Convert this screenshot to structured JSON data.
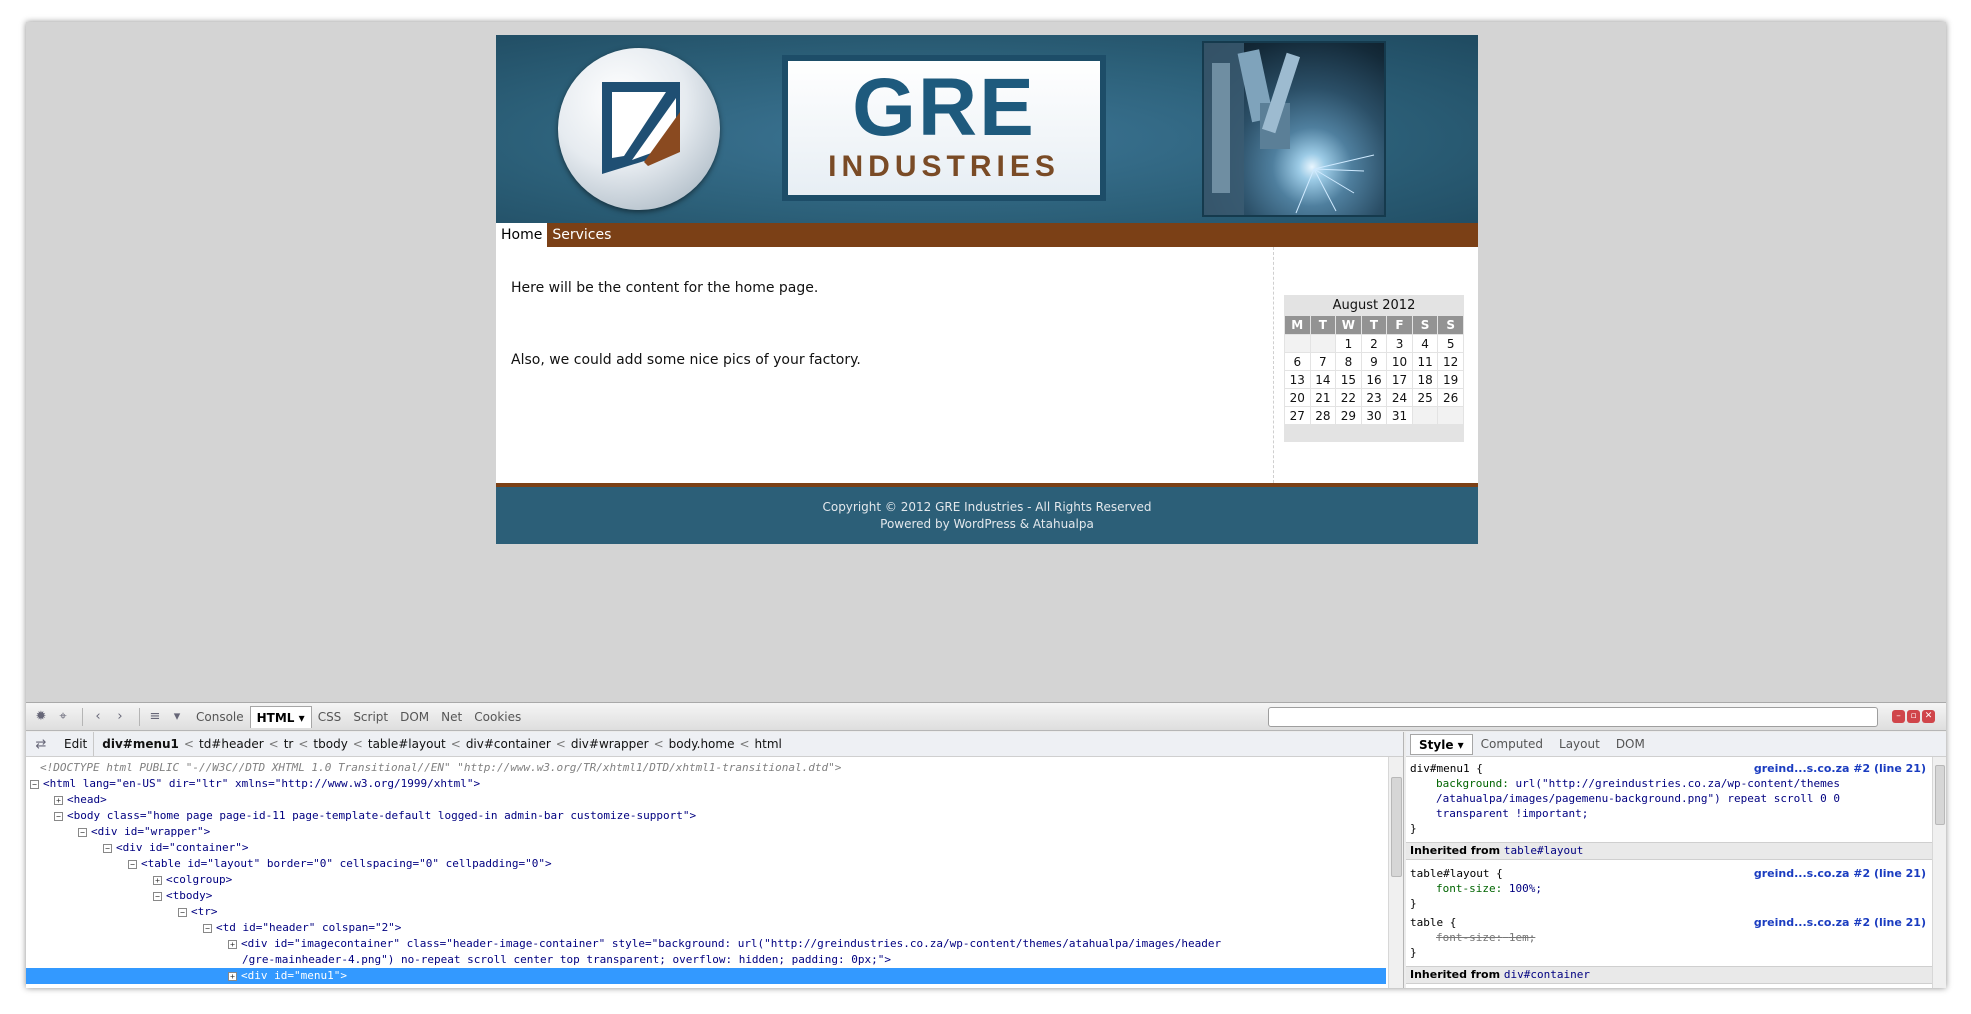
{
  "site": {
    "brand_title": "GRE",
    "brand_subtitle": "INDUSTRIES",
    "menu": [
      {
        "label": "Home"
      },
      {
        "label": "Services"
      }
    ],
    "content": {
      "paragraph1": "Here will be the content for the home page.",
      "paragraph2": "Also, we could add some nice pics of your factory."
    },
    "calendar": {
      "caption": "August 2012",
      "weekdays": [
        "M",
        "T",
        "W",
        "T",
        "F",
        "S",
        "S"
      ],
      "weeks": [
        [
          "",
          "",
          "1",
          "2",
          "3",
          "4",
          "5"
        ],
        [
          "6",
          "7",
          "8",
          "9",
          "10",
          "11",
          "12"
        ],
        [
          "13",
          "14",
          "15",
          "16",
          "17",
          "18",
          "19"
        ],
        [
          "20",
          "21",
          "22",
          "23",
          "24",
          "25",
          "26"
        ],
        [
          "27",
          "28",
          "29",
          "30",
          "31",
          "",
          ""
        ]
      ]
    },
    "footer": {
      "copyright": "Copyright © 2012 GRE Industries - All Rights Reserved",
      "powered": "Powered by WordPress & Atahualpa"
    }
  },
  "devtools": {
    "tabs": [
      "Console",
      "HTML",
      "CSS",
      "Script",
      "DOM",
      "Net",
      "Cookies"
    ],
    "active_tab": "HTML",
    "search_value": "",
    "edit_label": "Edit",
    "breadcrumbs": [
      "div#menu1",
      "td#header",
      "tr",
      "tbody",
      "table#layout",
      "div#container",
      "div#wrapper",
      "body.home",
      "html"
    ],
    "tree_lines": [
      "<!DOCTYPE html PUBLIC \"-//W3C//DTD XHTML 1.0 Transitional//EN\" \"http://www.w3.org/TR/xhtml1/DTD/xhtml1-transitional.dtd\">",
      "<html lang=\"en-US\" dir=\"ltr\" xmlns=\"http://www.w3.org/1999/xhtml\">",
      "<head>",
      "<body class=\"home page page-id-11 page-template-default logged-in admin-bar customize-support\">",
      "<div id=\"wrapper\">",
      "<div id=\"container\">",
      "<table id=\"layout\" border=\"0\" cellspacing=\"0\" cellpadding=\"0\">",
      "<colgroup>",
      "<tbody>",
      "<tr>",
      "<td id=\"header\" colspan=\"2\">",
      "<div id=\"imagecontainer\" class=\"header-image-container\" style=\"background: url(\"http://greindustries.co.za/wp-content/themes/atahualpa/images/header",
      "/gre-mainheader-4.png\") no-repeat scroll center top transparent; overflow: hidden; padding: 0px;\">",
      "<div id=\"menu1\">"
    ],
    "side_tabs": [
      "Style",
      "Computed",
      "Layout",
      "DOM"
    ],
    "active_side_tab": "Style",
    "rules": {
      "r1_selector": "div#menu1 {",
      "r1_source": "greind...s.co.za #2 (line 21)",
      "r1_prop": "background:",
      "r1_value_1": "url(\"http://greindustries.co.za/wp-content/themes",
      "r1_value_2": "/atahualpa/images/pagemenu-background.png\") repeat scroll 0 0",
      "r1_value_3": "transparent !important;",
      "close": "}",
      "inherited_label": "Inherited from",
      "inherited_1": "table#layout",
      "r2_selector": "table#layout {",
      "r2_source": "greind...s.co.za #2 (line 21)",
      "r2_prop": "font-size:",
      "r2_value": "100%;",
      "r3_selector": "table {",
      "r3_source": "greind...s.co.za #2 (line 21)",
      "r3_prop": "font-size:",
      "r3_value": "1em;",
      "inherited_2": "div#container"
    }
  }
}
